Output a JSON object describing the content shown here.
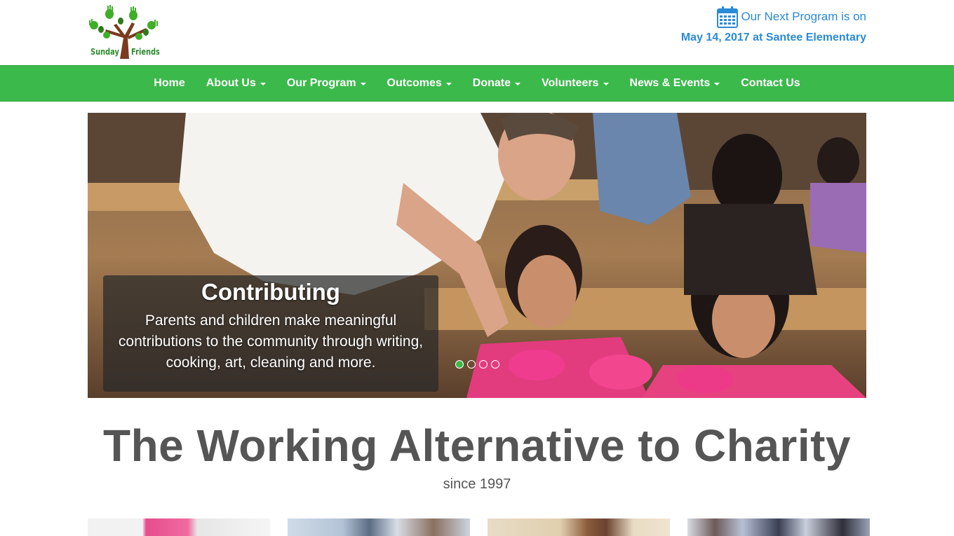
{
  "header": {
    "logo": {
      "word_left": "Sunday",
      "word_right": "Friends"
    },
    "next_program": {
      "line1": "Our Next Program is on",
      "line2": "May 14, 2017 at Santee Elementary",
      "icon": "calendar-icon"
    }
  },
  "nav": {
    "items": [
      {
        "label": "Home",
        "dropdown": false
      },
      {
        "label": "About Us",
        "dropdown": true
      },
      {
        "label": "Our Program",
        "dropdown": true
      },
      {
        "label": "Outcomes",
        "dropdown": true
      },
      {
        "label": "Donate",
        "dropdown": true
      },
      {
        "label": "Volunteers",
        "dropdown": true
      },
      {
        "label": "News & Events",
        "dropdown": true
      },
      {
        "label": "Contact Us",
        "dropdown": false
      }
    ]
  },
  "hero": {
    "caption_title": "Contributing",
    "caption_text": "Parents and children make meaningful contributions to the community through writing, cooking, art, cleaning and more.",
    "slide_count": 4,
    "active_slide": 1
  },
  "tagline": {
    "title": "The Working Alternative to Charity",
    "subtitle": "since 1997"
  },
  "colors": {
    "brand_green": "#3cb94b",
    "link_blue": "#2a8ad6",
    "text_gray": "#555555"
  }
}
